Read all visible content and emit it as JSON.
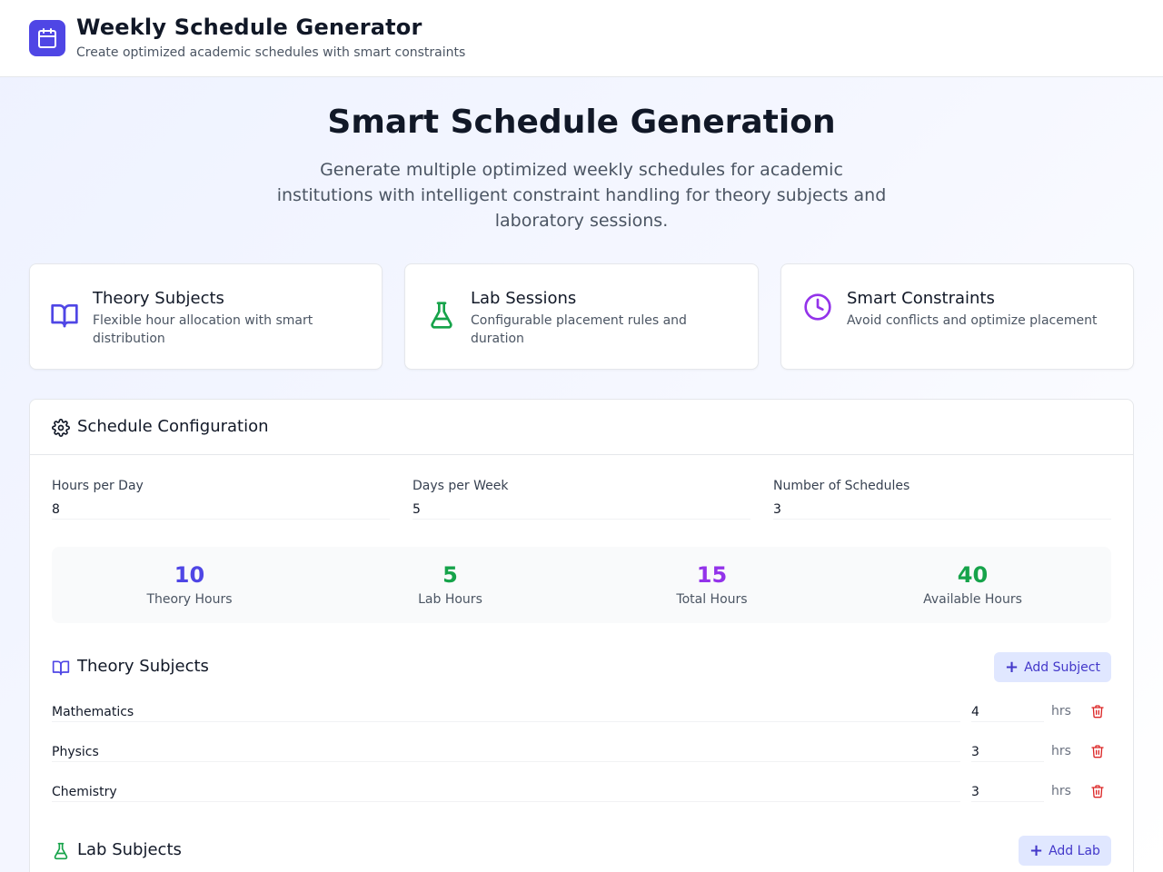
{
  "header": {
    "title": "Weekly Schedule Generator",
    "subtitle": "Create optimized academic schedules with smart constraints",
    "logo_icon": "calendar-icon"
  },
  "hero": {
    "title": "Smart Schedule Generation",
    "description": "Generate multiple optimized weekly schedules for academic institutions with intelligent constraint handling for theory subjects and laboratory sessions."
  },
  "features": [
    {
      "icon": "book-open-icon",
      "title": "Theory Subjects",
      "description": "Flexible hour allocation with smart distribution",
      "color": "#4f46e5"
    },
    {
      "icon": "flask-icon",
      "title": "Lab Sessions",
      "description": "Configurable placement rules and duration",
      "color": "#16a34a"
    },
    {
      "icon": "clock-icon",
      "title": "Smart Constraints",
      "description": "Avoid conflicts and optimize placement",
      "color": "#9333ea"
    }
  ],
  "config": {
    "title": "Schedule Configuration",
    "fields": [
      {
        "label": "Hours per Day",
        "value": "8"
      },
      {
        "label": "Days per Week",
        "value": "5"
      },
      {
        "label": "Number of Schedules",
        "value": "3"
      }
    ],
    "stats": [
      {
        "value": "10",
        "label": "Theory Hours",
        "color": "#4f46e5"
      },
      {
        "value": "5",
        "label": "Lab Hours",
        "color": "#16a34a"
      },
      {
        "value": "15",
        "label": "Total Hours",
        "color": "#9333ea"
      },
      {
        "value": "40",
        "label": "Available Hours",
        "color": "#16a34a"
      }
    ]
  },
  "theory": {
    "title": "Theory Subjects",
    "add_label": "Add Subject",
    "hrs_unit": "hrs",
    "subjects": [
      {
        "name": "Mathematics",
        "hours": "4"
      },
      {
        "name": "Physics",
        "hours": "3"
      },
      {
        "name": "Chemistry",
        "hours": "3"
      }
    ]
  },
  "labs": {
    "title": "Lab Subjects",
    "add_label": "Add Lab"
  },
  "colors": {
    "accent": "#4f46e5",
    "green": "#16a34a",
    "purple": "#9333ea",
    "danger": "#dc2626"
  }
}
